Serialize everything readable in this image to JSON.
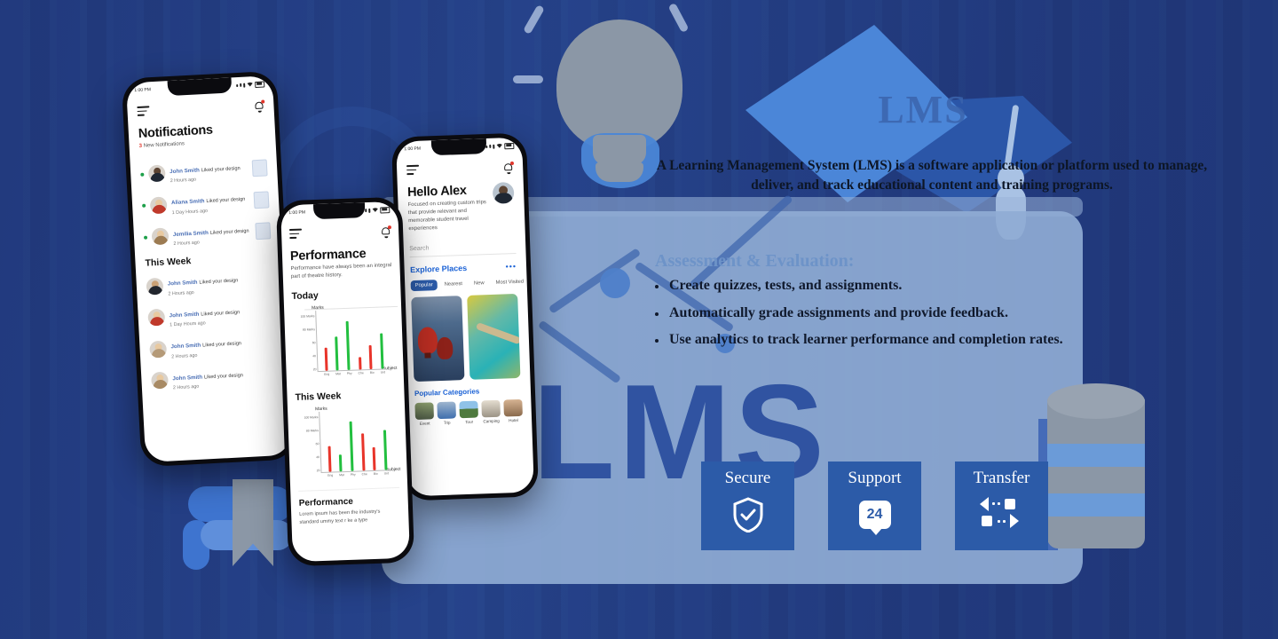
{
  "background": {
    "watermark_text": "LMS",
    "cap_label": "LMS",
    "navy": "#22397d",
    "panel_blue": "#8fabd4",
    "accent_blue": "#2c5ba8"
  },
  "content": {
    "lead_paragraph": "A Learning Management System (LMS) is a software application or platform used to manage, deliver, and track educational content and training programs.",
    "section_title": "Assessment & Evaluation:",
    "bullets": [
      "Create quizzes, tests, and assignments.",
      "Automatically grade assignments and provide feedback.",
      "Use analytics to track learner performance and completion rates."
    ]
  },
  "feature_cards": [
    {
      "label": "Secure",
      "icon": "shield-check-icon"
    },
    {
      "label": "Support",
      "icon": "chat-24-icon",
      "badge": "24"
    },
    {
      "label": "Transfer",
      "icon": "data-transfer-icon"
    }
  ],
  "phones": {
    "notifications": {
      "status_time": "1:00 PM",
      "title": "Notifications",
      "subtitle_count": "3",
      "subtitle_text": "New Notifications",
      "section_this_week": "This Week",
      "new_items": [
        {
          "name": "John Smith",
          "action": "Liked your design",
          "time": "2 Hours ago",
          "head": "#5c4433",
          "body": "#1f2733"
        },
        {
          "name": "Aliana Smith",
          "action": "Liked your design",
          "time": "1 Day Hours ago",
          "head": "#e8c9a0",
          "body": "#c0392b"
        },
        {
          "name": "Jemilia Smith",
          "action": "Liked your design",
          "time": "2 Hours ago",
          "head": "#e8c9a0",
          "body": "#9c7b52"
        }
      ],
      "week_items": [
        {
          "name": "John Smith",
          "action": "Liked your design",
          "time": "2 Hours ago",
          "head": "#caa176",
          "body": "#22262e"
        },
        {
          "name": "John Smith",
          "action": "Liked your design",
          "time": "1 Day Hours ago",
          "head": "#e8c9a0",
          "body": "#c0392b"
        },
        {
          "name": "John Smith",
          "action": "Liked your design",
          "time": "2 Hours ago",
          "head": "#e8c9a0",
          "body": "#b59a78"
        },
        {
          "name": "John Smith",
          "action": "Liked your design",
          "time": "2 Hours ago",
          "head": "#e8c9a0",
          "body": "#a88a64"
        }
      ]
    },
    "performance": {
      "status_time": "1:00 PM",
      "title": "Performance",
      "subtitle": "Performance have always been an integral part of theatre history.",
      "section_today": "Today",
      "section_this_week": "This Week",
      "footer_title": "Performance",
      "footer_text": "Lorem ipsum has been the industry's standard ummy text r ke a type"
    },
    "explore": {
      "status_time": "1:00 PM",
      "greeting": "Hello Alex",
      "subtitle": "Focused on creating custom trips that provide relevant and memorable student travel experiences",
      "search_placeholder": "Search",
      "explore_heading": "Explore Places",
      "more_dots": "•••",
      "tabs": [
        {
          "label": "Popular",
          "active": true
        },
        {
          "label": "Nearest",
          "active": false
        },
        {
          "label": "New",
          "active": false
        },
        {
          "label": "Most Visited",
          "active": false
        }
      ],
      "categories_heading": "Popular Categories",
      "categories": [
        {
          "label": "Event",
          "color": "#6f7f6a"
        },
        {
          "label": "Trip",
          "color": "#7e94ae"
        },
        {
          "label": "Tour",
          "color": "#6c9a6b"
        },
        {
          "label": "Camping",
          "color": "#b9b2a3"
        },
        {
          "label": "Hotel",
          "color": "#a8896c"
        }
      ]
    }
  },
  "chart_data": [
    {
      "type": "bar",
      "title": "Today",
      "xlabel": "Subject",
      "ylabel": "Marks",
      "categories": [
        "Eng",
        "Mat",
        "Phy",
        "Che",
        "Bio",
        "Urd"
      ],
      "values": [
        38,
        55,
        80,
        20,
        40,
        58
      ],
      "colors": [
        "#e8342a",
        "#22bf3f",
        "#22bf3f",
        "#e8342a",
        "#e8342a",
        "#22bf3f"
      ],
      "ytick_labels": [
        "100 Marks",
        "80 Marks",
        "60",
        "40",
        "20"
      ],
      "ylim": [
        0,
        100
      ],
      "grid": false,
      "legend": "none"
    },
    {
      "type": "bar",
      "title": "This Week",
      "xlabel": "Subject",
      "ylabel": "Marks",
      "categories": [
        "Eng",
        "Mat",
        "Phy",
        "Che",
        "Bio",
        "Urd"
      ],
      "values": [
        42,
        28,
        82,
        62,
        38,
        66
      ],
      "colors": [
        "#e8342a",
        "#22bf3f",
        "#22bf3f",
        "#e8342a",
        "#e8342a",
        "#22bf3f"
      ],
      "ytick_labels": [
        "100 Marks",
        "80 Marks",
        "60",
        "40",
        "20"
      ],
      "ylim": [
        0,
        100
      ],
      "grid": false,
      "legend": "none"
    }
  ]
}
